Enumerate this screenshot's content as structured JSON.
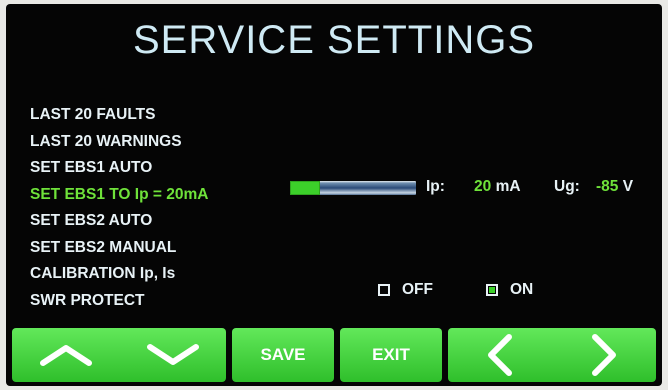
{
  "title": "SERVICE SETTINGS",
  "menu": {
    "items": [
      "LAST 20 FAULTS",
      "LAST 20 WARNINGS",
      "SET EBS1 AUTO",
      "SET EBS1 TO Ip = 20mA",
      "SET EBS2 AUTO",
      "SET EBS2 MANUAL",
      "CALIBRATION Ip, Is",
      "SWR PROTECT"
    ],
    "selected_index": 3
  },
  "gauge": {
    "level_fraction": 0.24,
    "fill_color": "#3cd02a"
  },
  "readouts": {
    "ip_label": "Ip:",
    "ip_value": "20",
    "ip_unit": "mA",
    "ug_label": "Ug:",
    "ug_value": "-85",
    "ug_unit": "V"
  },
  "swr_protect": {
    "off_label": "OFF",
    "on_label": "ON",
    "selected": "ON"
  },
  "buttons": {
    "save_label": "SAVE",
    "exit_label": "EXIT"
  },
  "icons": [
    "chevron-up-icon",
    "chevron-down-icon",
    "chevron-left-icon",
    "chevron-right-icon"
  ],
  "colors": {
    "background": "#050505",
    "title": "#cfeaf4",
    "text": "#e8f2f6",
    "accent_green": "#6fe23a",
    "button_green": "#3fd03a"
  }
}
